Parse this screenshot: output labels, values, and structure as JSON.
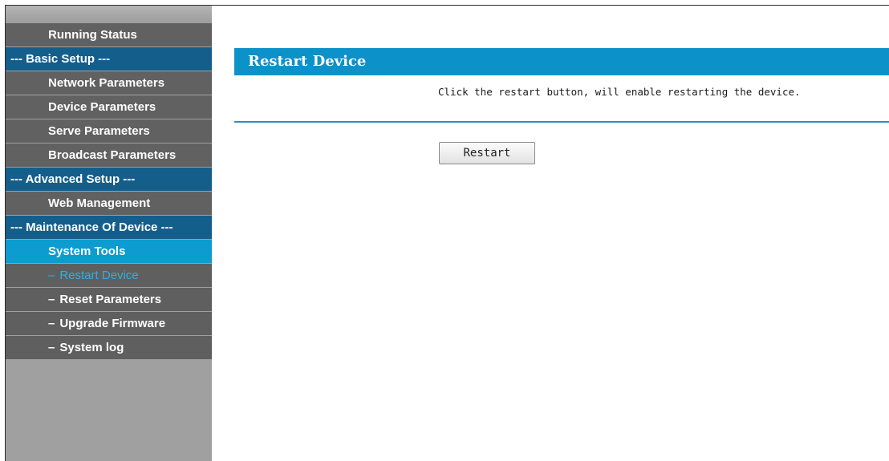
{
  "sidebar": {
    "items": [
      {
        "label": "Running Status",
        "kind": "gray"
      },
      {
        "label": "--- Basic Setup ---",
        "kind": "header"
      },
      {
        "label": "Network Parameters",
        "kind": "gray"
      },
      {
        "label": "Device Parameters",
        "kind": "gray"
      },
      {
        "label": "Serve Parameters",
        "kind": "gray"
      },
      {
        "label": "Broadcast Parameters",
        "kind": "gray"
      },
      {
        "label": "--- Advanced Setup ---",
        "kind": "header"
      },
      {
        "label": "Web Management",
        "kind": "gray"
      },
      {
        "label": "--- Maintenance Of Device ---",
        "kind": "header"
      },
      {
        "label": "System Tools",
        "kind": "selected"
      },
      {
        "label": "Restart Device",
        "kind": "active-sub"
      },
      {
        "label": "Reset Parameters",
        "kind": "sub"
      },
      {
        "label": "Upgrade Firmware",
        "kind": "sub"
      },
      {
        "label": "System log",
        "kind": "sub"
      }
    ]
  },
  "main": {
    "title": "Restart Device",
    "description": "Click the restart button, will enable restarting the device.",
    "restart_label": "Restart"
  },
  "colors": {
    "title_bar": "#0c91c8",
    "nav_header": "#145e8c",
    "nav_selected": "#0c9cd0",
    "nav_item": "#616161",
    "active_sub_text": "#2cb0e8"
  }
}
